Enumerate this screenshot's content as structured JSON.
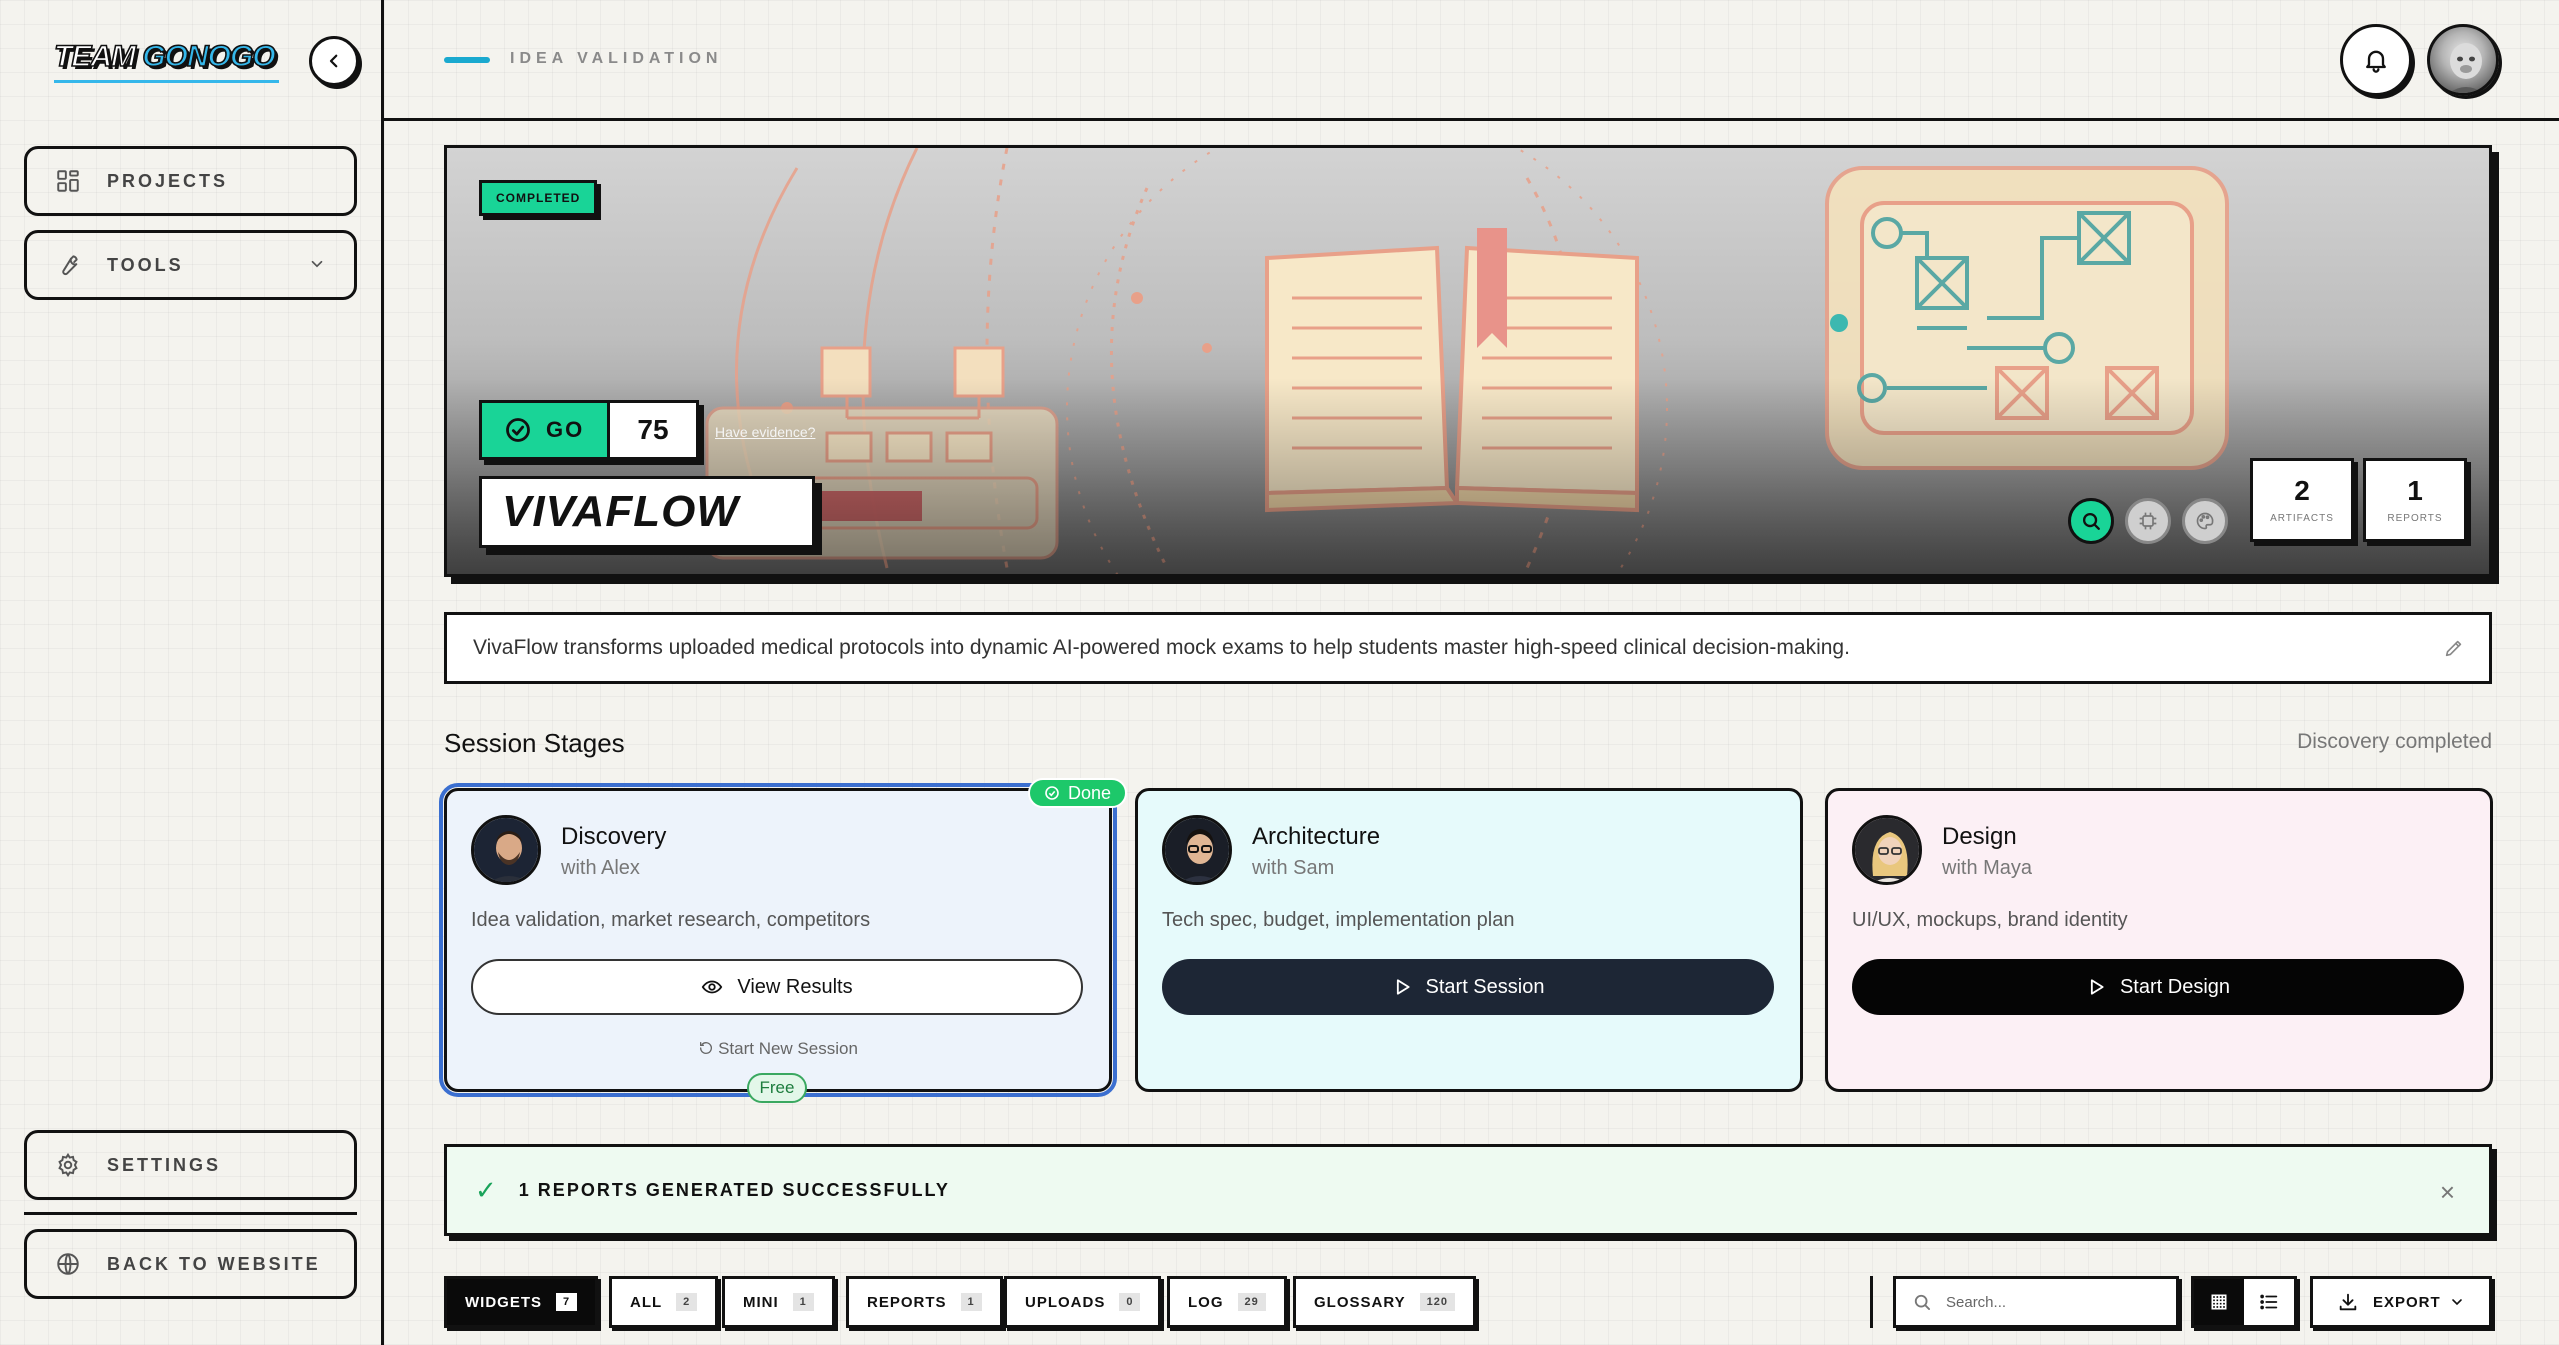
{
  "sidebar": {
    "logo_part1": "TEAM ",
    "logo_part2": "GONOGO",
    "nav": {
      "projects": "PROJECTS",
      "tools": "TOOLS",
      "settings": "SETTINGS",
      "back": "BACK TO WEBSITE"
    }
  },
  "header": {
    "breadcrumb": "IDEA VALIDATION"
  },
  "hero": {
    "status_badge": "COMPLETED",
    "verdict": "GO",
    "score": "75",
    "evidence_link": "Have evidence?",
    "project_name": "VIVAFLOW",
    "artifacts_count": "2",
    "artifacts_label": "ARTIFACTS",
    "reports_count": "1",
    "reports_label": "REPORTS"
  },
  "description": "VivaFlow transforms uploaded medical protocols into dynamic AI-powered mock exams to help students master high-speed clinical decision-making.",
  "stages": {
    "title": "Session Stages",
    "status": "Discovery completed",
    "done_badge": "Done",
    "free_badge": "Free",
    "cards": [
      {
        "name": "Discovery",
        "with": "with Alex",
        "subtitle": "Idea validation, market research, competitors",
        "button": "View Results",
        "secondary": "Start New Session"
      },
      {
        "name": "Architecture",
        "with": "with Sam",
        "subtitle": "Tech spec, budget, implementation plan",
        "button": "Start Session"
      },
      {
        "name": "Design",
        "with": "with Maya",
        "subtitle": "UI/UX, mockups, brand identity",
        "button": "Start Design"
      }
    ]
  },
  "banner": {
    "check": "✓",
    "message": "1 REPORTS GENERATED SUCCESSFULLY",
    "close": "×"
  },
  "tabs": [
    {
      "label": "WIDGETS",
      "count": "7"
    },
    {
      "label": "ALL",
      "count": "2"
    },
    {
      "label": "MINI",
      "count": "1"
    },
    {
      "label": "REPORTS",
      "count": "1"
    },
    {
      "label": "UPLOADS",
      "count": "0"
    },
    {
      "label": "LOG",
      "count": "29"
    },
    {
      "label": "GLOSSARY",
      "count": "120"
    }
  ],
  "toolbar": {
    "search_placeholder": "Search...",
    "export_label": "EXPORT"
  },
  "colors": {
    "accent_green": "#19d497",
    "accent_blue": "#35b7ea",
    "navy": "#1d2635",
    "success": "#1dc86a"
  },
  "icons": {
    "collapse": "chevron-left-icon",
    "projects": "grid-icon",
    "tools": "wrench-icon",
    "settings": "gear-icon",
    "back": "globe-icon",
    "bell": "bell-icon",
    "search": "search-icon",
    "export": "download-icon"
  }
}
